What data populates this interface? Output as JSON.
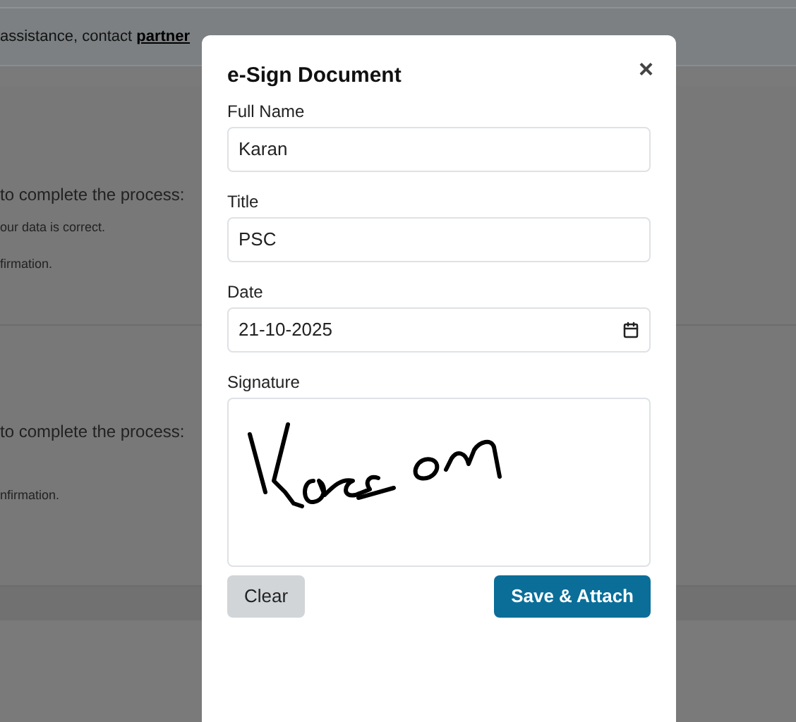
{
  "background": {
    "banner": {
      "text": "assistance, contact ",
      "link": "partner"
    },
    "sections": [
      {
        "intro": "to complete the process:",
        "lines": [
          "our data is correct.",
          "firmation."
        ]
      },
      {
        "intro": "to complete the process:",
        "lines": [
          "nfirmation."
        ]
      }
    ]
  },
  "dialog": {
    "title": "e-Sign Document",
    "close": "×",
    "fields": [
      {
        "kind": "text",
        "label": "Full Name",
        "value": "Karan"
      },
      {
        "kind": "text",
        "label": "Title",
        "value": "PSC"
      },
      {
        "kind": "date",
        "label": "Date",
        "value": "21-10-2025"
      },
      {
        "kind": "signature",
        "label": "Signature"
      }
    ],
    "buttons": [
      {
        "label": "Clear",
        "kind": "secondary"
      },
      {
        "label": "Save & Attach",
        "kind": "primary"
      }
    ]
  }
}
